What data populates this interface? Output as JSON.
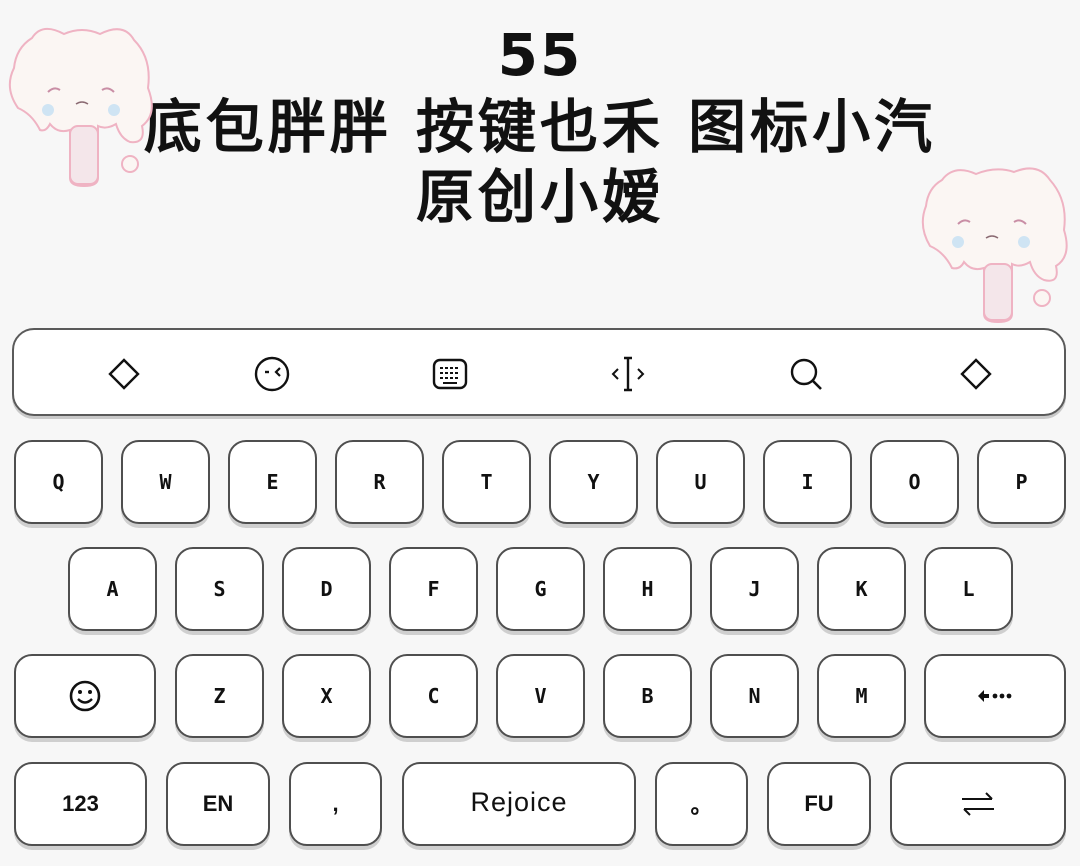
{
  "header": {
    "number": "55",
    "line1": "底包胖胖 按键也禾 图标小汽",
    "line2": "原创小嫒"
  },
  "toolbar": {
    "icons": [
      "diamond-icon",
      "emoji-face-icon",
      "keyboard-icon",
      "cursor-icon",
      "search-icon",
      "diamond-icon"
    ]
  },
  "keyboard": {
    "row1": [
      "Q",
      "W",
      "E",
      "R",
      "T",
      "Y",
      "U",
      "I",
      "O",
      "P"
    ],
    "row2": [
      "A",
      "S",
      "D",
      "F",
      "G",
      "H",
      "J",
      "K",
      "L"
    ],
    "row3": [
      "Z",
      "X",
      "C",
      "V",
      "B",
      "N",
      "M"
    ],
    "row3_left_icon": "smiley-icon",
    "row3_right_icon": "backspace-icon",
    "row4": {
      "numbers": "123",
      "lang": "EN",
      "comma": ",",
      "space": "Rejoice",
      "period": "。",
      "fu": "FU",
      "enter_icon": "swap-arrows-icon"
    }
  },
  "colors": {
    "background": "#f7f7f7",
    "key_fill": "#ffffff",
    "key_border": "#4f4f4f",
    "mascot_outline": "#f0b7c6"
  }
}
